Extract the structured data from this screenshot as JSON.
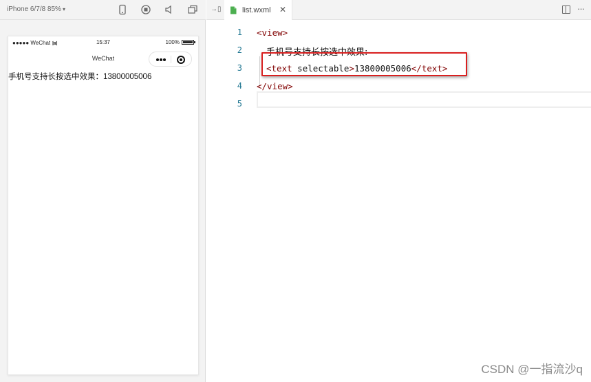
{
  "simulator": {
    "device_label": "iPhone 6/7/8 85%",
    "device_caret": "▾",
    "toolbar_icons": [
      "phone-icon",
      "record-icon",
      "volume-icon",
      "window-icon"
    ],
    "status_bar": {
      "carrier": "●●●●● WeChat",
      "time": "15:37",
      "battery": "100%",
      "battery_level": 1.0
    },
    "nav_title": "WeChat",
    "page_text": "手机号支持长按选中效果：13800005006"
  },
  "editor": {
    "tab": {
      "label": "list.wxml",
      "close": "✕"
    },
    "collapse_glyph": "→▯",
    "lines": [
      {
        "number": "1",
        "parts": [
          {
            "type": "tag",
            "text": "<view>"
          }
        ]
      },
      {
        "number": "2",
        "parts": [
          {
            "type": "text",
            "text": "手机号支持长按选中效果:"
          }
        ]
      },
      {
        "number": "3",
        "parts": [
          {
            "type": "tag",
            "text": "<text"
          },
          {
            "type": "attr",
            "text": " selectable"
          },
          {
            "type": "tag",
            "text": ">"
          },
          {
            "type": "value",
            "text": "13800005006"
          },
          {
            "type": "tag",
            "text": "</text>"
          }
        ]
      },
      {
        "number": "4",
        "parts": [
          {
            "type": "tag",
            "text": "</view>"
          }
        ]
      },
      {
        "number": "5",
        "parts": []
      }
    ]
  },
  "watermark": "CSDN @一指流沙q",
  "colors": {
    "tag": "#800000",
    "line_number": "#237893",
    "highlight_border": "#d91f1f"
  }
}
